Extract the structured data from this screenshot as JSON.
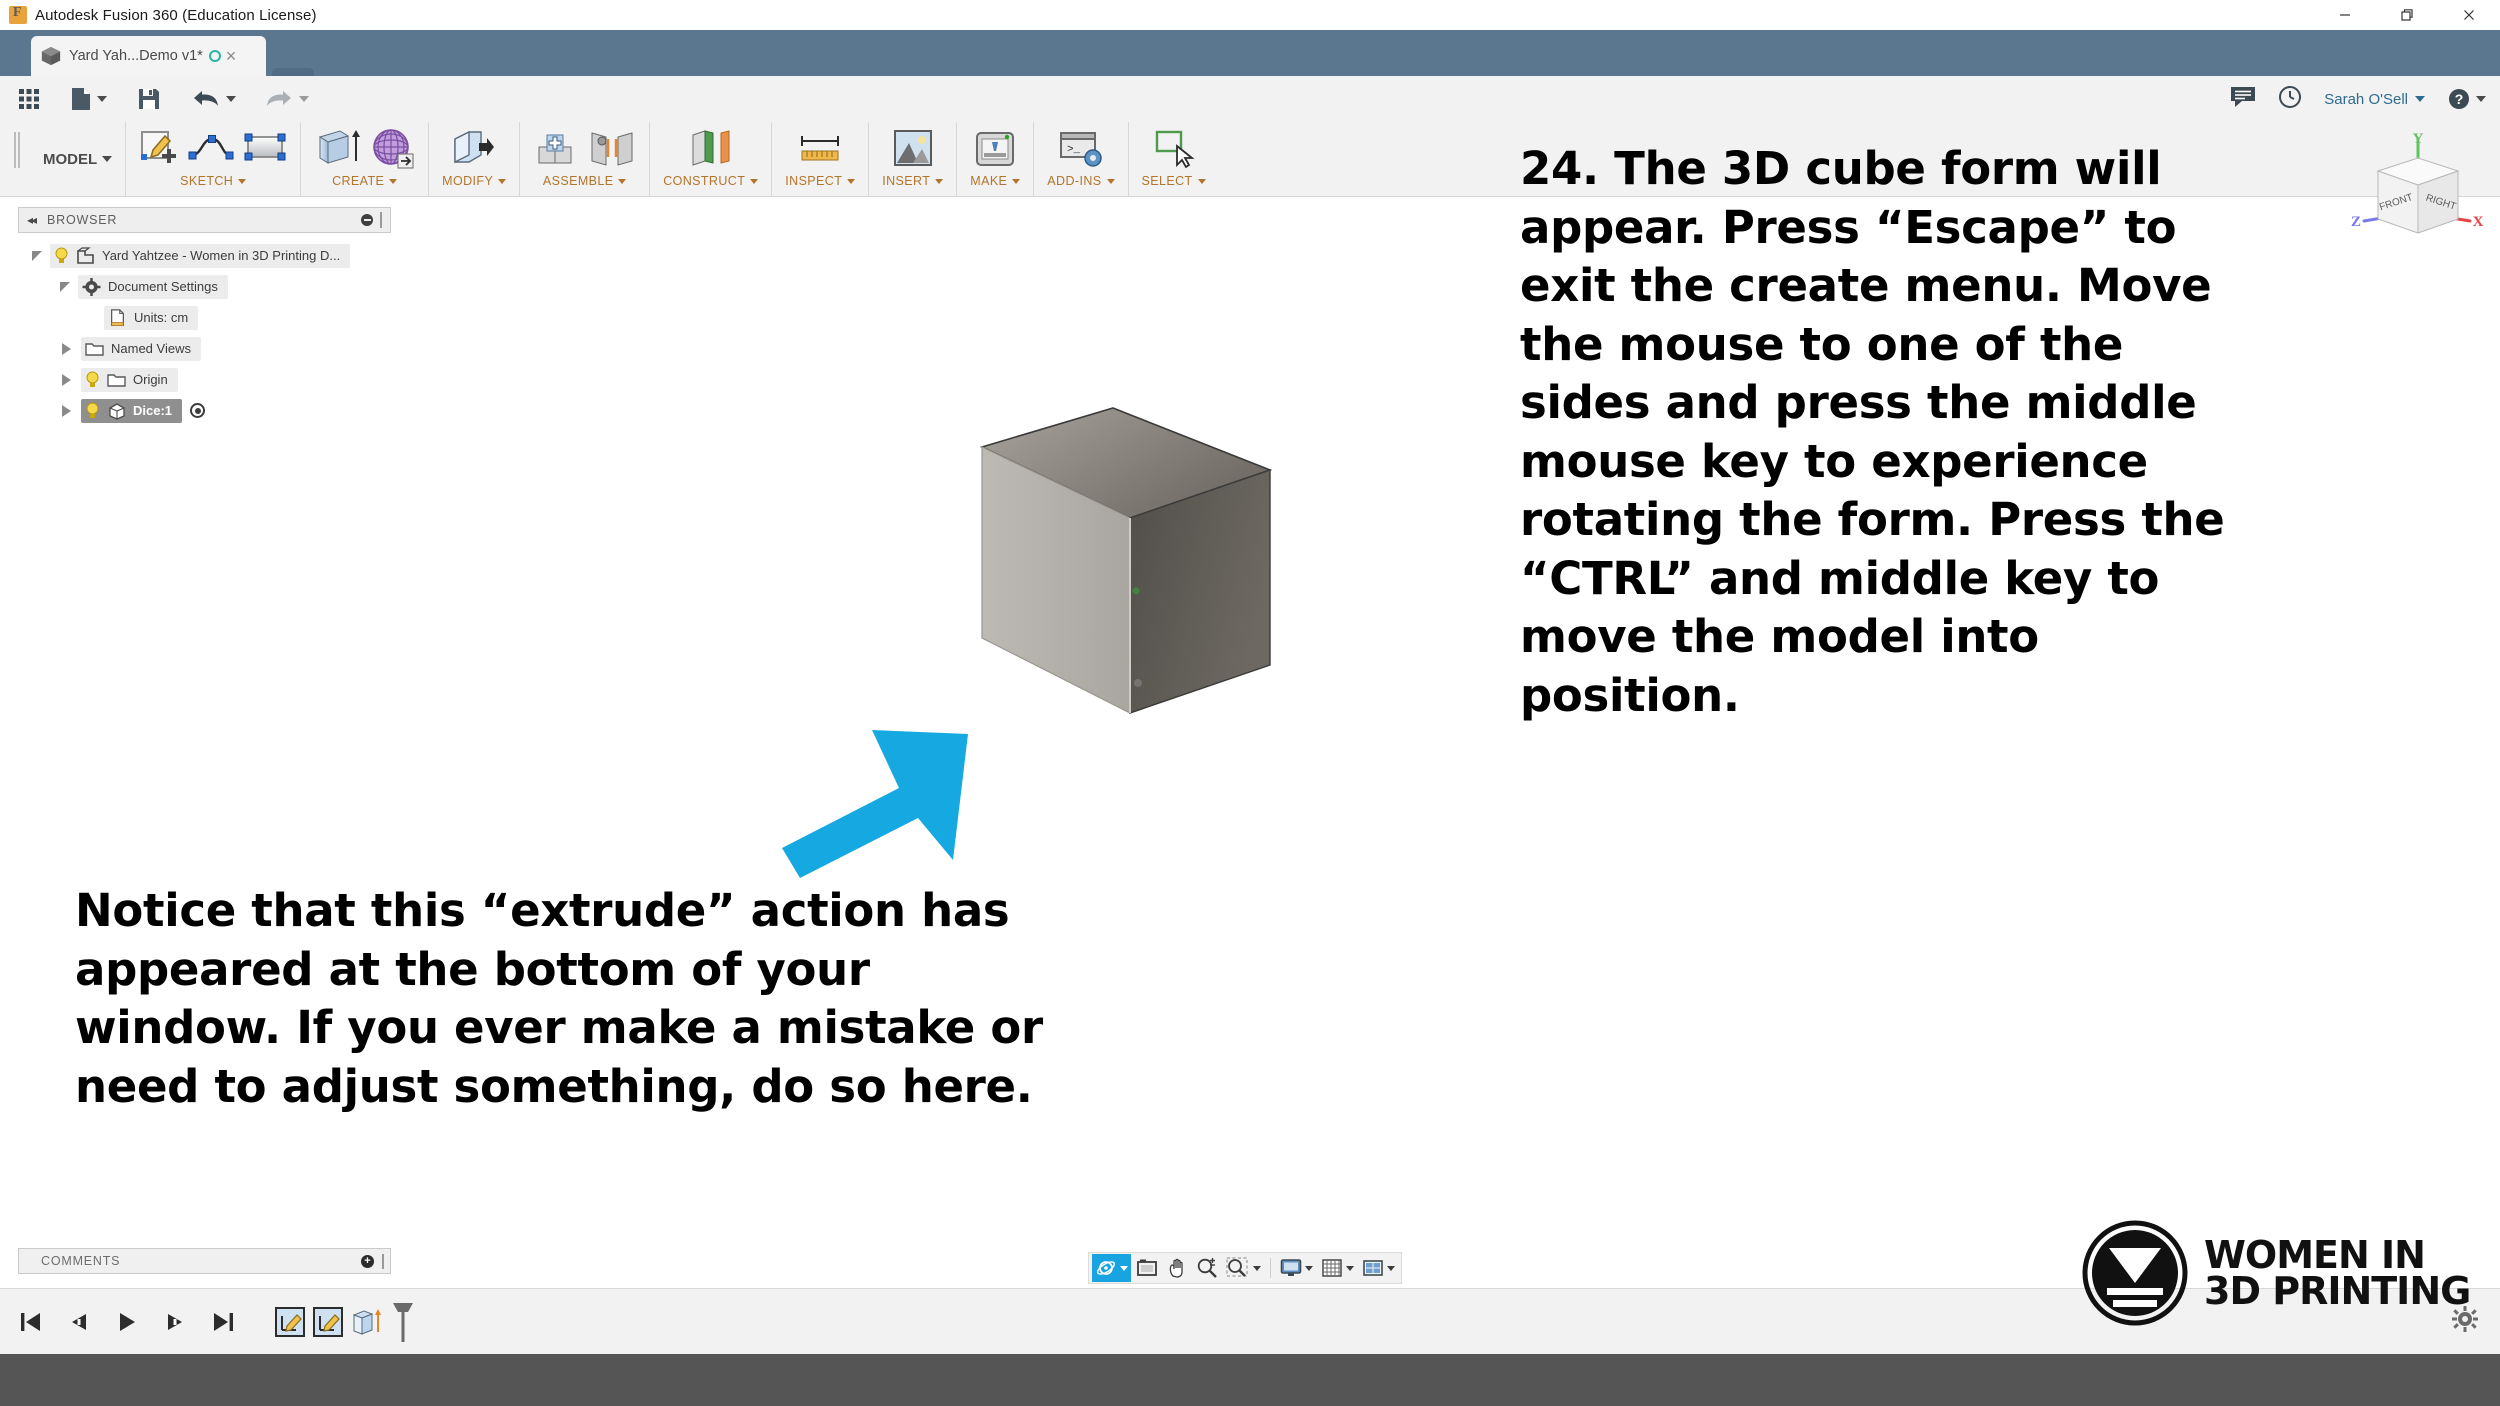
{
  "window": {
    "title": "Autodesk Fusion 360 (Education License)",
    "app_icon": "fusion-logo-icon",
    "minimize_label": "Minimize",
    "maximize_label": "Restore",
    "close_label": "Close"
  },
  "tabstrip": {
    "document_tab_label": "Yard Yah...Demo v1*",
    "document_tab_icon": "cube-icon",
    "unsaved_indicator": "sync-circle-icon",
    "close_tab_label": "×",
    "new_tab_label": "+"
  },
  "quick_access": {
    "items": [
      {
        "name": "show-data-panel",
        "icon": "grid-9-icon"
      },
      {
        "name": "file-menu",
        "icon": "file-icon",
        "has_caret": true
      },
      {
        "name": "save",
        "icon": "floppy-disk-icon",
        "has_caret": false
      },
      {
        "name": "undo",
        "icon": "undo-arrow-icon",
        "has_caret": true
      },
      {
        "name": "redo",
        "icon": "redo-arrow-icon",
        "has_caret": true
      }
    ],
    "right_items": [
      {
        "name": "comments-panel",
        "icon": "speech-bubble-icon"
      },
      {
        "name": "job-status",
        "icon": "clock-icon"
      }
    ],
    "user_name": "Sarah O'Sell",
    "help_label": "?"
  },
  "ribbon": {
    "workspace_label": "MODEL",
    "groups": [
      {
        "label": "SKETCH",
        "icons": [
          "create-sketch-icon",
          "spline-icon",
          "rectangle-icon"
        ]
      },
      {
        "label": "CREATE",
        "icons": [
          "extrude-icon",
          "form-sculpt-icon"
        ]
      },
      {
        "label": "MODIFY",
        "icons": [
          "press-pull-icon"
        ]
      },
      {
        "label": "ASSEMBLE",
        "icons": [
          "new-component-icon",
          "joint-icon"
        ]
      },
      {
        "label": "CONSTRUCT",
        "icons": [
          "offset-plane-icon"
        ]
      },
      {
        "label": "INSPECT",
        "icons": [
          "measure-ruler-icon"
        ]
      },
      {
        "label": "INSERT",
        "icons": [
          "insert-image-icon"
        ]
      },
      {
        "label": "MAKE",
        "icons": [
          "3d-print-icon"
        ]
      },
      {
        "label": "ADD-INS",
        "icons": [
          "scripts-addins-icon"
        ]
      },
      {
        "label": "SELECT",
        "icons": [
          "select-window-icon"
        ]
      }
    ]
  },
  "browser": {
    "panel_title": "BROWSER",
    "collapse_icon": "double-chevron-left-icon",
    "minimize_icon": "minimize-dot-icon",
    "tree": [
      {
        "label": "Yard Yahtzee - Women in 3D Printing D...",
        "indent": 0,
        "triangle": "open",
        "bulb": true,
        "icon": "component-icon",
        "selected": false,
        "radio": false
      },
      {
        "label": "Document Settings",
        "indent": 1,
        "triangle": "open",
        "bulb": false,
        "icon": "gear-icon",
        "selected": false,
        "radio": false
      },
      {
        "label": "Units: cm",
        "indent": 2,
        "triangle": "blank",
        "bulb": false,
        "icon": "units-document-icon",
        "selected": false,
        "radio": false
      },
      {
        "label": "Named Views",
        "indent": 1,
        "triangle": "closed",
        "bulb": false,
        "icon": "folder-icon",
        "selected": false,
        "radio": false
      },
      {
        "label": "Origin",
        "indent": 1,
        "triangle": "closed",
        "bulb": true,
        "icon": "folder-icon",
        "selected": false,
        "radio": false
      },
      {
        "label": "Dice:1",
        "indent": 1,
        "triangle": "closed",
        "bulb": true,
        "icon": "body-cube-icon",
        "selected": true,
        "radio": true
      }
    ]
  },
  "viewcube": {
    "front_label": "FRONT",
    "right_label": "RIGHT",
    "axis_x": "X",
    "axis_y": "Y",
    "axis_z": "Z",
    "color_x": "#e8424a",
    "color_y": "#5ec45e",
    "color_z": "#6a6adf"
  },
  "canvas": {
    "model_name": "Dice extruded cube",
    "arrow_color": "#16a8e0"
  },
  "annotations": {
    "right_text": "24. The 3D cube form will appear. Press “Escape” to exit the create menu. Move the mouse to one of the sides and press the middle mouse key to experience rotating the form. Press the “CTRL” and middle key to move the model into position.",
    "left_text": "Notice that this “extrude” action has appeared at the bottom of your window. If you ever make a mistake or need to adjust something, do so here."
  },
  "comments": {
    "panel_title": "COMMENTS",
    "add_icon": "add-comment-icon",
    "add_label": "+"
  },
  "navigation_bar": {
    "items": [
      {
        "name": "orbit-tool",
        "icon": "orbit-icon",
        "active": true,
        "has_caret": true
      },
      {
        "name": "look-at-tool",
        "icon": "look-at-icon",
        "active": false,
        "has_caret": false
      },
      {
        "name": "pan-tool",
        "icon": "hand-pan-icon",
        "active": false,
        "has_caret": false
      },
      {
        "name": "zoom-tool",
        "icon": "zoom-plusminus-icon",
        "active": false,
        "has_caret": false
      },
      {
        "name": "zoom-window-tool",
        "icon": "zoom-window-icon",
        "active": false,
        "has_caret": true
      },
      {
        "name": "display-settings",
        "icon": "monitor-icon",
        "active": false,
        "has_caret": true
      },
      {
        "name": "grid-snaps",
        "icon": "grid-icon",
        "active": false,
        "has_caret": true
      },
      {
        "name": "viewports",
        "icon": "viewports-icon",
        "active": false,
        "has_caret": true
      }
    ]
  },
  "timeline": {
    "controls": [
      {
        "name": "jump-to-beginning",
        "icon": "skip-back-icon"
      },
      {
        "name": "step-back",
        "icon": "step-back-icon"
      },
      {
        "name": "play",
        "icon": "play-icon"
      },
      {
        "name": "step-forward",
        "icon": "step-forward-icon"
      },
      {
        "name": "jump-to-end",
        "icon": "skip-forward-icon"
      }
    ],
    "features": [
      {
        "name": "sketch-feature-1",
        "icon": "sketch-feature-icon"
      },
      {
        "name": "sketch-feature-2",
        "icon": "sketch-feature-icon"
      },
      {
        "name": "extrude-feature",
        "icon": "extrude-feature-icon"
      }
    ],
    "marker_name": "timeline-end-marker",
    "settings_icon": "gear-icon"
  },
  "branding": {
    "logo_icon": "women-in-3d-printing-logo",
    "line1": "WOMEN IN",
    "line2": "3D PRINTING"
  }
}
